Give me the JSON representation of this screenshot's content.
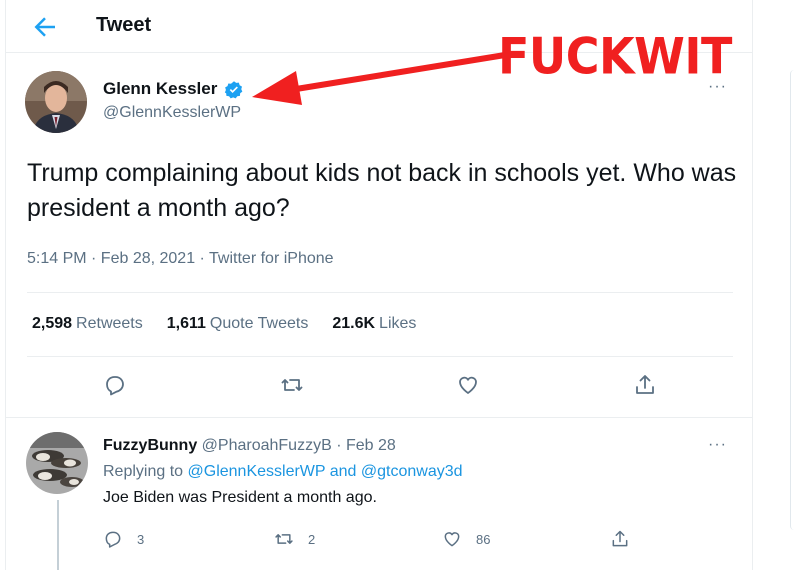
{
  "header": {
    "title": "Tweet"
  },
  "tweet": {
    "author_name": "Glenn Kessler",
    "author_handle": "@GlennKesslerWP",
    "more": "···",
    "text": "Trump complaining about kids not back in schools yet. Who was president a month ago?",
    "meta": "5:14 PM · Feb 28, 2021 · Twitter for iPhone",
    "stats": {
      "retweets_count": "2,598",
      "retweets_label": "Retweets",
      "quotes_count": "1,611",
      "quotes_label": "Quote Tweets",
      "likes_count": "21.6K",
      "likes_label": "Likes"
    },
    "actions": [
      "reply-icon",
      "retweet-icon",
      "like-icon",
      "share-icon"
    ]
  },
  "annotation": {
    "text": "FUCKWIT",
    "color": "#f02020"
  },
  "reply": {
    "author_name": "FuzzyBunny",
    "author_handle": "@PharoahFuzzyB",
    "separator": " · ",
    "date": "Feb 28",
    "more": "···",
    "replying_prefix": "Replying to ",
    "mention1": "@GlennKesslerWP",
    "and": " and ",
    "mention2": "@gtconway3d",
    "text": "Joe Biden was President a month ago.",
    "reply_count": "3",
    "retweet_count": "2",
    "like_count": "86"
  },
  "colors": {
    "accent": "#1da1f2",
    "secondary_text": "#5b7083",
    "mention": "#1b95e0"
  }
}
